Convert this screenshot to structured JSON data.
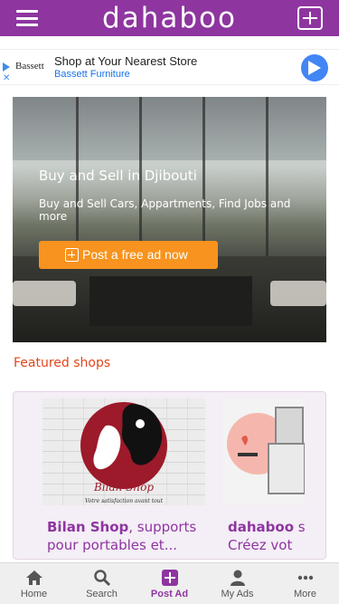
{
  "header": {
    "menu_icon": "hamburger-icon",
    "logo": "dahaboo",
    "add_icon": "plus-square-icon",
    "background": "#8e35a0"
  },
  "ad": {
    "brand": "Bassett",
    "title": "Shop at Your Nearest Store",
    "subtitle": "Bassett Furniture",
    "cta_icon": "directions-arrow-icon",
    "close_glyph": "✕"
  },
  "hero": {
    "title": "Buy and Sell in Djibouti",
    "subtitle": "Buy and Sell Cars, Appartments, Find Jobs and more",
    "button_label": "Post a free ad now",
    "button_color": "#f7931e"
  },
  "featured": {
    "title": "Featured shops",
    "title_color": "#e2451c",
    "shops": [
      {
        "name": "Bilan Shop",
        "tagline": ", supports",
        "line2": "pour portables et...",
        "image_text": "Bilan Shop",
        "image_caption": "Votre satisfaction avant tout"
      },
      {
        "name": "dahaboo",
        "tagline": " s",
        "line2": "Créez vot"
      }
    ]
  },
  "bottom_nav": {
    "items": [
      {
        "label": "Home",
        "icon": "home-icon"
      },
      {
        "label": "Search",
        "icon": "search-icon"
      },
      {
        "label": "Post Ad",
        "icon": "plus-square-icon",
        "active": true
      },
      {
        "label": "My Ads",
        "icon": "user-icon"
      },
      {
        "label": "More",
        "icon": "more-dots-icon"
      }
    ],
    "active_color": "#8e35a0"
  }
}
